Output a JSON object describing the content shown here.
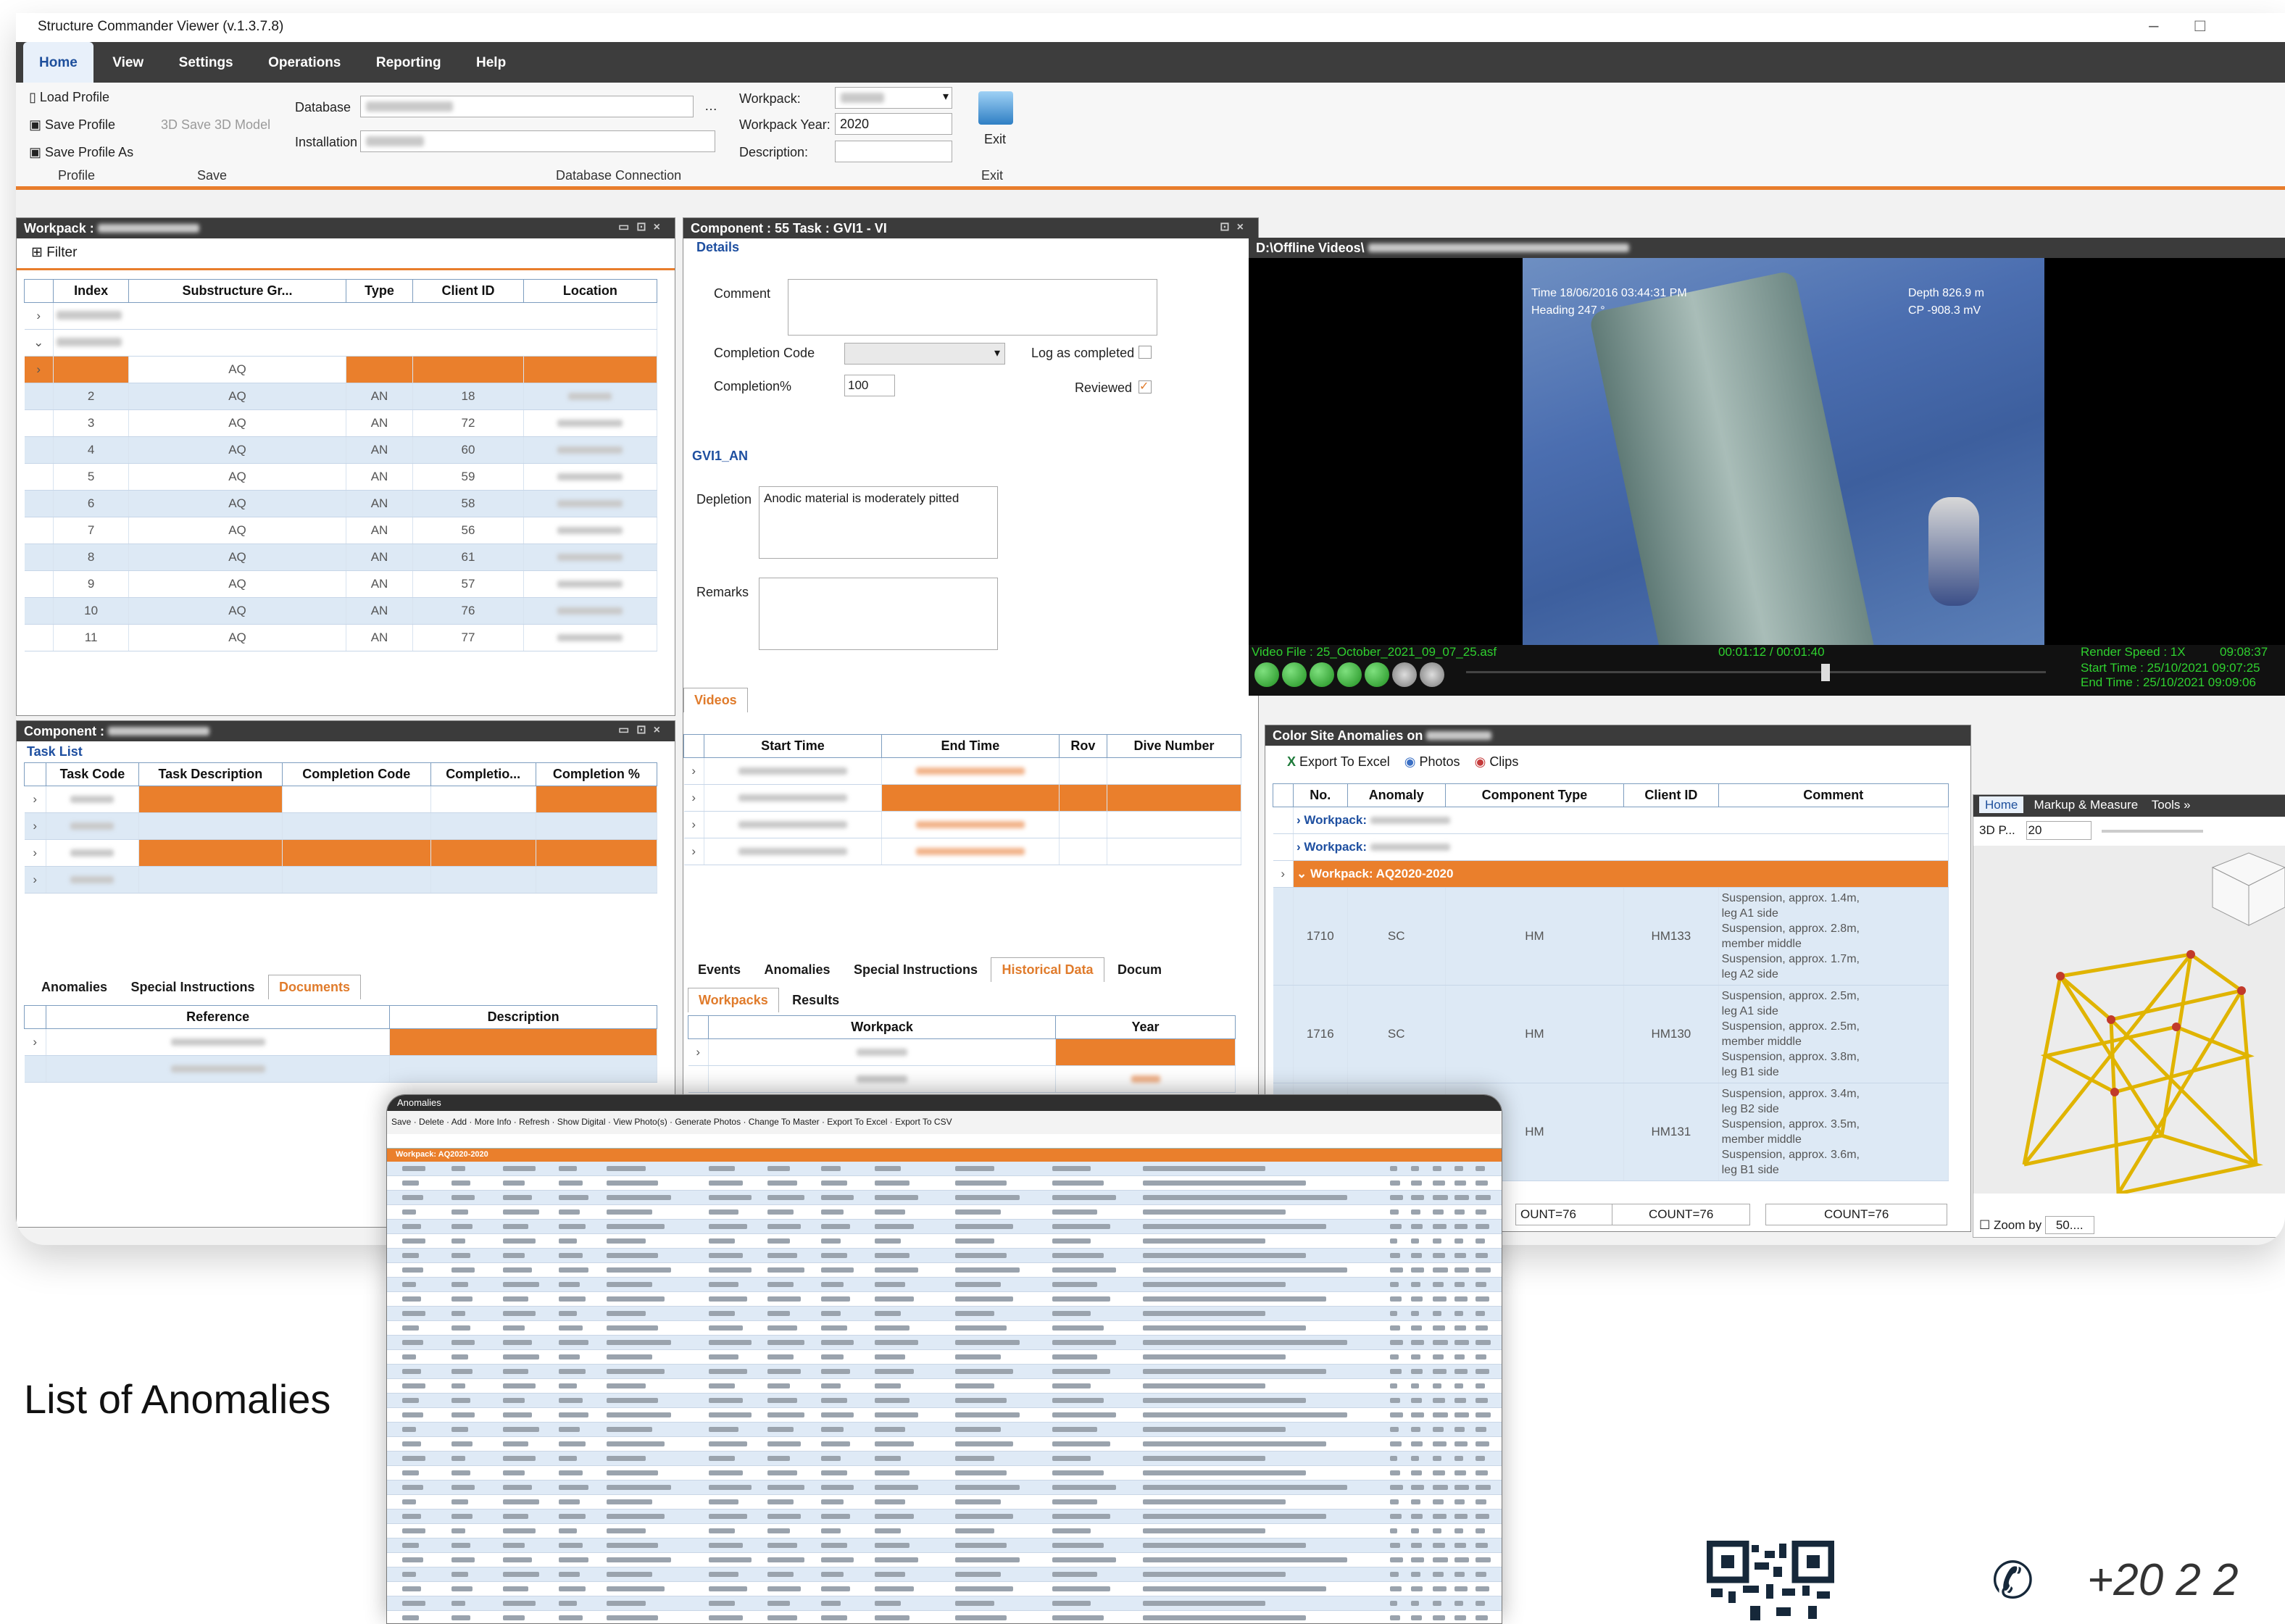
{
  "app": {
    "title": "Structure Commander Viewer (v.1.3.7.8)"
  },
  "menu": [
    "Home",
    "View",
    "Settings",
    "Operations",
    "Reporting",
    "Help"
  ],
  "ribbon": {
    "load_profile": "Load Profile",
    "save_profile": "Save Profile",
    "save_profile_as": "Save Profile As",
    "save_3d": "Save 3D Model",
    "database_label": "Database",
    "installation_label": "Installation",
    "workpack_label": "Workpack:",
    "workpack_year_label": "Workpack Year:",
    "workpack_year_value": "2020",
    "description_label": "Description:",
    "exit": "Exit",
    "groups": [
      "Profile",
      "Save",
      "Database Connection",
      "Exit"
    ]
  },
  "workpack_panel": {
    "title": "Workpack :",
    "filter": "Filter",
    "columns": [
      "Index",
      "Substructure Gr...",
      "Type",
      "Client ID",
      "Location"
    ]
  },
  "component_panel": {
    "title": "Component :",
    "task_list": "Task List",
    "columns": [
      "Task Code",
      "Task Description",
      "Completion Code",
      "Completio...",
      "Completion %"
    ],
    "tabs": [
      "Anomalies",
      "Special Instructions",
      "Documents"
    ],
    "doc_columns": [
      "Reference",
      "Description"
    ]
  },
  "task_panel": {
    "title": "Component : 55  Task : GVI1 - VI",
    "details": "Details",
    "comment": "Comment",
    "completion_code": "Completion Code",
    "log_completed": "Log as completed",
    "completion_pct": "Completion%",
    "completion_value": "100",
    "reviewed": "Reviewed",
    "section": "GVI1_AN",
    "depletion": "Depletion",
    "depletion_value": "Anodic material is moderately pitted",
    "remarks": "Remarks",
    "videos": "Videos",
    "video_columns": [
      "Start Time",
      "End Time",
      "Rov",
      "Dive Number"
    ],
    "tabs": [
      "Events",
      "Anomalies",
      "Special Instructions",
      "Historical Data",
      "Docum"
    ],
    "subtabs": [
      "Workpacks",
      "Results"
    ],
    "hist_columns": [
      "Workpack",
      "Year"
    ]
  },
  "video": {
    "title": "D:\\Offline Videos\\",
    "overlay_time": "Time 18/06/2016 03:44:31 PM",
    "overlay_heading": "Heading 247 °",
    "overlay_depth": "Depth 826.9 m",
    "overlay_cp": "CP -908.3 mV",
    "file": "Video File : 25_October_2021_09_07_25.asf",
    "position": "00:01:12 / 00:01:40",
    "render_speed": "Render Speed : 1X",
    "clock": "09:08:37",
    "start_time": "Start Time : 25/10/2021 09:07:25",
    "end_time": "End Time  : 25/10/2021 09:09:06"
  },
  "anomalies": {
    "title": "Color Site Anomalies on",
    "export": "Export To Excel",
    "photos": "Photos",
    "clips": "Clips",
    "columns": [
      "No.",
      "Anomaly",
      "Component Type",
      "Client ID",
      "Comment"
    ],
    "groups": [
      "Workpack:",
      "Workpack:",
      "Workpack: AQ2020-2020"
    ],
    "rows": [
      {
        "no": "1710",
        "anomaly": "SC",
        "type": "HM",
        "client": "HM133",
        "comment": [
          "Suspension, approx. 1.4m,",
          "leg A1 side",
          "Suspension, approx. 2.8m,",
          "member middle",
          "Suspension, approx. 1.7m,",
          "leg A2 side"
        ]
      },
      {
        "no": "1716",
        "anomaly": "SC",
        "type": "HM",
        "client": "HM130",
        "comment": [
          "Suspension, approx. 2.5m,",
          "leg A1 side",
          "Suspension, approx. 2.5m,",
          "member middle",
          "Suspension, approx. 3.8m,",
          "leg B1 side"
        ]
      },
      {
        "no": "",
        "anomaly": "",
        "type": "HM",
        "client": "HM131",
        "comment": [
          "Suspension, approx. 3.4m,",
          "leg B2 side",
          "Suspension, approx. 3.5m,",
          "member middle",
          "Suspension, approx. 3.6m,",
          "leg B1 side"
        ]
      }
    ],
    "counts": [
      "OUNT=76",
      "COUNT=76",
      "COUNT=76"
    ]
  },
  "view3d": {
    "tabs": [
      "Home",
      "Markup & Measure",
      "Tools"
    ],
    "zoom_value": "20",
    "zoom_by": "Zoom by",
    "zoom_by_value": "50....",
    "preset": "3D P..."
  },
  "popup": {
    "title": "Anomalies",
    "toolbar": [
      "Save",
      "Delete",
      "Add",
      "More Info",
      "Refresh",
      "Show Digital",
      "View Photo(s)",
      "Generate Photos",
      "Change To Master",
      "Export To Excel",
      "Export To CSV"
    ],
    "group": "Workpack: AQ2020-2020"
  },
  "caption": "List of Anomalies",
  "phone": "+20  2  2"
}
